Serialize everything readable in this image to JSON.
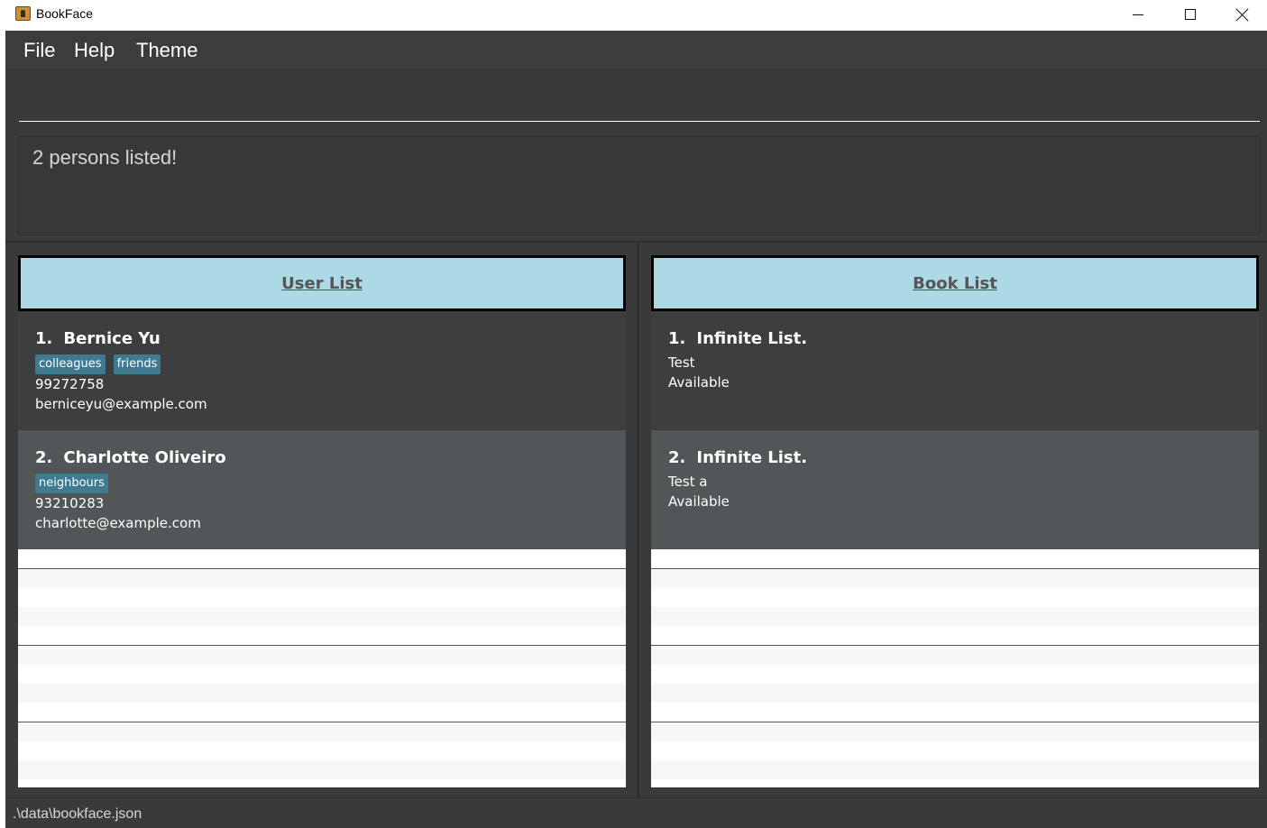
{
  "window": {
    "title": "BookFace",
    "app_icon": "bookface-app-icon",
    "controls": {
      "minimize": "minimize-icon",
      "maximize": "maximize-icon",
      "close": "close-icon"
    }
  },
  "menu": {
    "items": [
      "File",
      "Help",
      "Theme"
    ]
  },
  "command": {
    "value": ""
  },
  "result": {
    "text": "2 persons listed!"
  },
  "users": {
    "header": "User List",
    "items": [
      {
        "index": "1.",
        "name": "Bernice Yu",
        "tags": [
          "colleagues",
          "friends"
        ],
        "phone": "99272758",
        "email": "berniceyu@example.com"
      },
      {
        "index": "2.",
        "name": "Charlotte Oliveiro",
        "tags": [
          "neighbours"
        ],
        "phone": "93210283",
        "email": "charlotte@example.com"
      }
    ]
  },
  "books": {
    "header": "Book List",
    "items": [
      {
        "index": "1.",
        "title": "Infinite List.",
        "line1": "Test",
        "status": "Available"
      },
      {
        "index": "2.",
        "title": "Infinite List.",
        "line1": "Test a",
        "status": "Available"
      }
    ]
  },
  "status": {
    "path": ".\\data\\bookface.json"
  },
  "colors": {
    "header_bg": "#add8e6",
    "tag_bg": "#3e7b91",
    "card_odd": "#3c3e3f",
    "card_even": "#515658",
    "app_bg": "#3a3a3a"
  }
}
